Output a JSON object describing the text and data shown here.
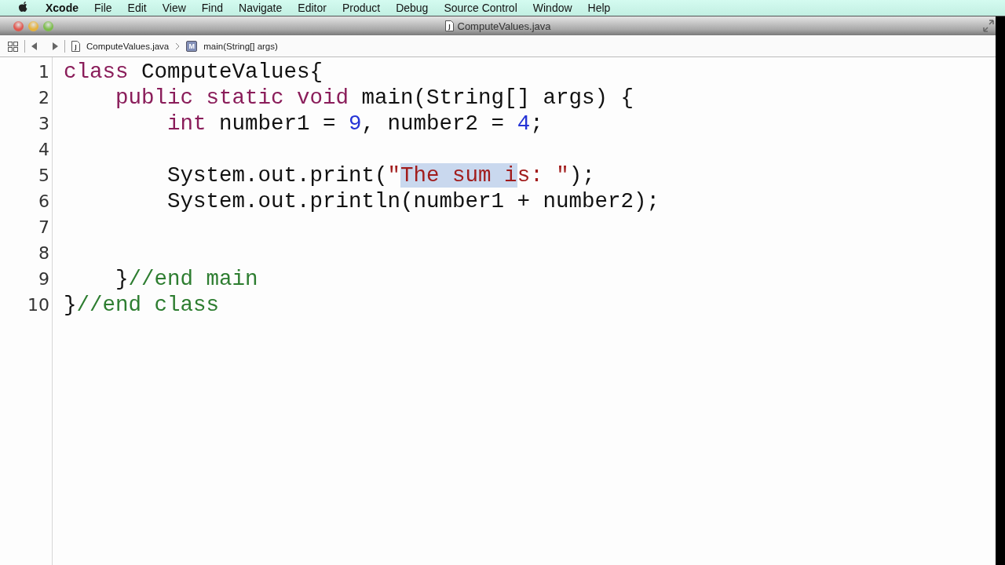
{
  "menu_bar": {
    "app": "Xcode",
    "items": [
      "File",
      "Edit",
      "View",
      "Find",
      "Navigate",
      "Editor",
      "Product",
      "Debug",
      "Source Control",
      "Window",
      "Help"
    ]
  },
  "window": {
    "title": "ComputeValues.java"
  },
  "jump_bar": {
    "file": "ComputeValues.java",
    "method_badge": "M",
    "method": "main(String[] args)"
  },
  "editor": {
    "lines": [
      {
        "number": "1",
        "tokens": [
          {
            "kind": "keyword",
            "text": "class",
            "selected": false
          },
          {
            "kind": "plain",
            "text": " ComputeValues{",
            "selected": false
          }
        ]
      },
      {
        "number": "2",
        "tokens": [
          {
            "kind": "keyword",
            "text": "    public static void",
            "selected": false
          },
          {
            "kind": "plain",
            "text": " main(String[] args) {",
            "selected": false
          }
        ]
      },
      {
        "number": "3",
        "tokens": [
          {
            "kind": "keyword",
            "text": "        int",
            "selected": false
          },
          {
            "kind": "plain",
            "text": " number1 = ",
            "selected": false
          },
          {
            "kind": "number",
            "text": "9",
            "selected": false
          },
          {
            "kind": "plain",
            "text": ", number2 = ",
            "selected": false
          },
          {
            "kind": "number",
            "text": "4",
            "selected": false
          },
          {
            "kind": "plain",
            "text": ";",
            "selected": false
          }
        ]
      },
      {
        "number": "4"
      },
      {
        "number": "5",
        "tokens": [
          {
            "kind": "plain",
            "text": "        System.out.print(",
            "selected": false
          },
          {
            "kind": "string",
            "text": "\"",
            "selected": false
          },
          {
            "kind": "string",
            "text": "The sum i",
            "selected": true
          },
          {
            "kind": "string",
            "text": "s: \"",
            "selected": false
          },
          {
            "kind": "plain",
            "text": ");",
            "selected": false
          }
        ]
      },
      {
        "number": "6",
        "tokens": [
          {
            "kind": "plain",
            "text": "        System.out.println(number1 + number2);",
            "selected": false
          }
        ]
      },
      {
        "number": "7"
      },
      {
        "number": "8"
      },
      {
        "number": "9",
        "tokens": [
          {
            "kind": "plain",
            "text": "    }",
            "selected": false
          },
          {
            "kind": "comment",
            "text": "//end main",
            "selected": false
          }
        ]
      },
      {
        "number": "10",
        "tokens": [
          {
            "kind": "plain",
            "text": "}",
            "selected": false
          },
          {
            "kind": "comment",
            "text": "//end class",
            "selected": false
          }
        ]
      }
    ]
  }
}
